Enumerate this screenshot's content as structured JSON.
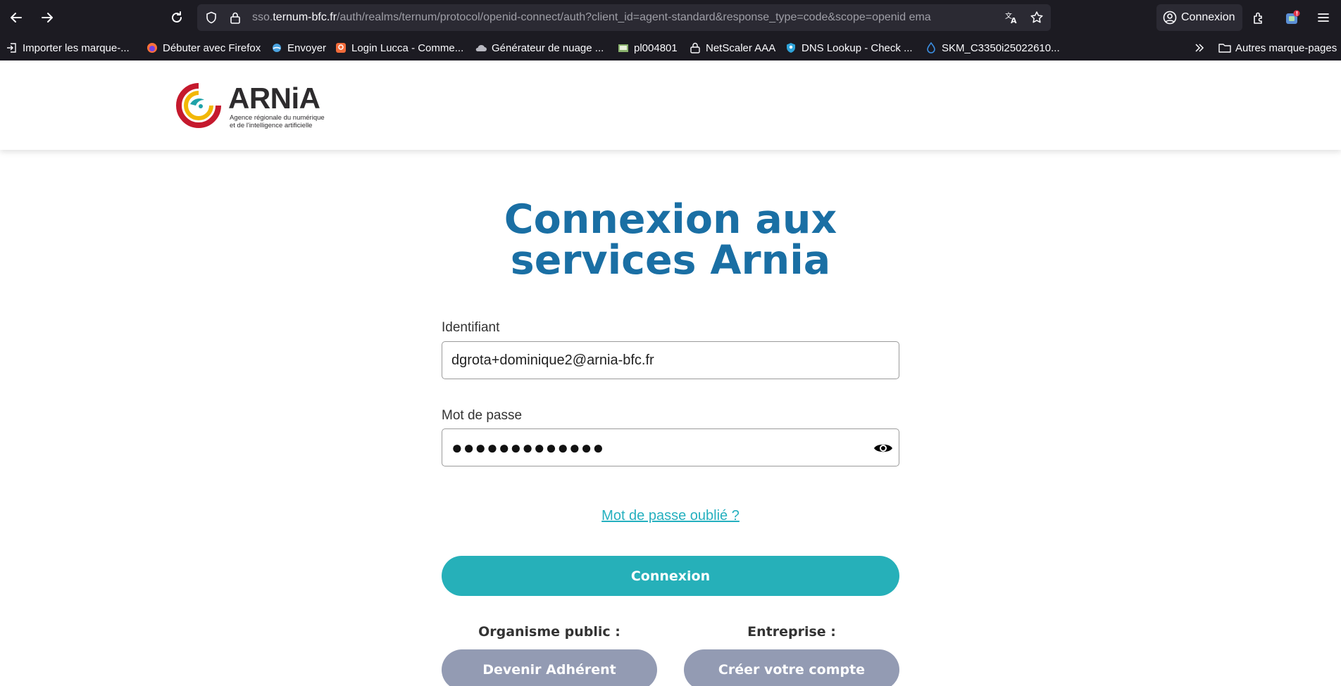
{
  "browser": {
    "url_prefix": "sso.",
    "url_domain": "ternum-bfc.fr",
    "url_path": "/auth/realms/ternum/protocol/openid-connect/auth?client_id=agent-standard&response_type=code&scope=openid ema",
    "account_label": "Connexion",
    "bookmarks": [
      "Importer les marque-...",
      "Débuter avec Firefox",
      "Envoyer",
      "Login Lucca - Comme...",
      "Générateur de nuage ...",
      "pl004801",
      "NetScaler AAA",
      "DNS Lookup - Check ...",
      "SKM_C3350i25022610..."
    ],
    "other_bookmarks": "Autres marque-pages"
  },
  "header": {
    "logo_word": "ARNiA",
    "logo_tagline_1": "Agence régionale du numérique",
    "logo_tagline_2": "et de l'intelligence artificielle"
  },
  "login": {
    "title_line1": "Connexion aux",
    "title_line2": "services Arnia",
    "username_label": "Identifiant",
    "username_value": "dgrota+dominique2@arnia-bfc.fr",
    "password_label": "Mot de passe",
    "password_masked": "●●●●●●●●●●●●●",
    "forgot_link": "Mot de passe oublié ?",
    "submit_label": "Connexion",
    "public_label": "Organisme public :",
    "public_button": "Devenir Adhérent",
    "company_label": "Entreprise :",
    "company_button": "Créer votre compte"
  },
  "colors": {
    "title": "#1a6fa4",
    "primary_button": "#26b0b9",
    "secondary_button": "#939bb3",
    "link": "#25b0bf",
    "chrome": "#1c1b22"
  }
}
